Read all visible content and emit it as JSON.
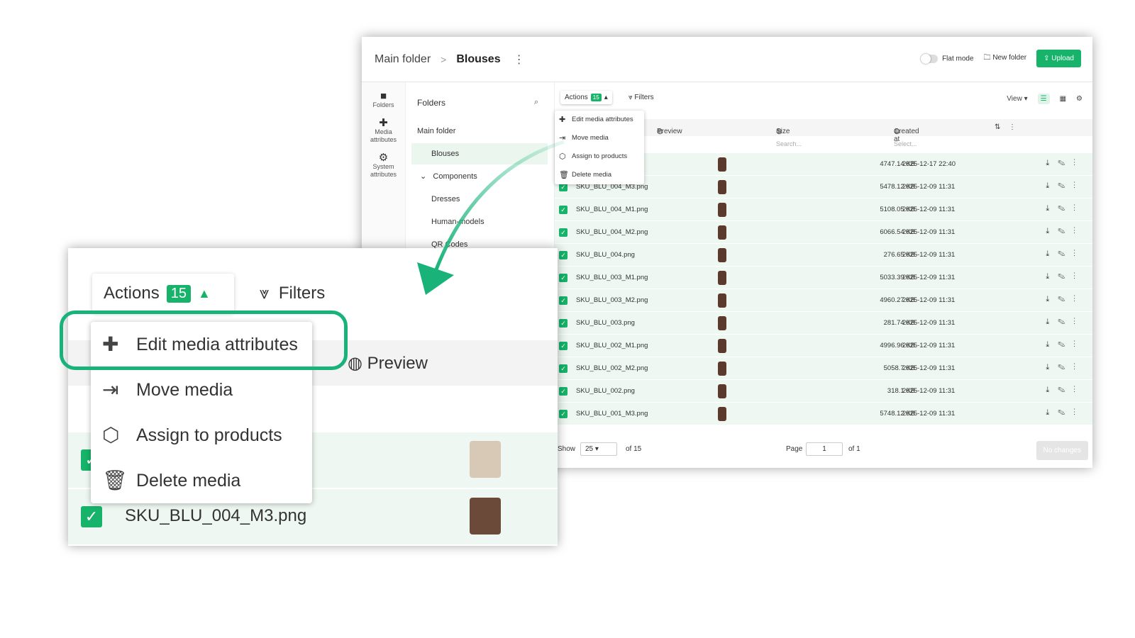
{
  "breadcrumb": {
    "root": "Main folder",
    "separator": ">",
    "current": "Blouses",
    "menu_icon": "vertical-dots-icon"
  },
  "topbar": {
    "flat_mode": "Flat mode",
    "new_folder": "New folder",
    "upload": "Upload"
  },
  "rail": [
    {
      "icon": "folder-icon",
      "label": "Folders"
    },
    {
      "icon": "puzzle-icon",
      "label": "Media attributes"
    },
    {
      "icon": "gear-icon",
      "label": "System attributes"
    }
  ],
  "folders": {
    "title": "Folders",
    "items": [
      "Main folder",
      "Blouses",
      "Components",
      "Dresses",
      "Human-models",
      "QR Codes"
    ]
  },
  "toolbar": {
    "actions": "Actions",
    "actions_count": "15",
    "filters": "Filters",
    "view": "View"
  },
  "menu": [
    "Edit media attributes",
    "Move media",
    "Assign to products",
    "Delete media"
  ],
  "table": {
    "headers": {
      "preview": "Preview",
      "size": "Size",
      "created": "Created at"
    },
    "filters": {
      "size": "Search...",
      "created": "Select..."
    },
    "rows": [
      {
        "name": "",
        "size": "4747.14 KB",
        "date": "2025-12-17 22:40"
      },
      {
        "name": "SKU_BLU_004_M3.png",
        "size": "5478.12 KB",
        "date": "2025-12-09 11:31"
      },
      {
        "name": "SKU_BLU_004_M1.png",
        "size": "5108.05 KB",
        "date": "2025-12-09 11:31"
      },
      {
        "name": "SKU_BLU_004_M2.png",
        "size": "6066.54 KB",
        "date": "2025-12-09 11:31"
      },
      {
        "name": "SKU_BLU_004.png",
        "size": "276.65 KB",
        "date": "2025-12-09 11:31"
      },
      {
        "name": "SKU_BLU_003_M1.png",
        "size": "5033.39 KB",
        "date": "2025-12-09 11:31"
      },
      {
        "name": "SKU_BLU_003_M2.png",
        "size": "4960.27 KB",
        "date": "2025-12-09 11:31"
      },
      {
        "name": "SKU_BLU_003.png",
        "size": "281.74 KB",
        "date": "2025-12-09 11:31"
      },
      {
        "name": "SKU_BLU_002_M1.png",
        "size": "4996.96 KB",
        "date": "2025-12-09 11:31"
      },
      {
        "name": "SKU_BLU_002_M2.png",
        "size": "5058.7 KB",
        "date": "2025-12-09 11:31"
      },
      {
        "name": "SKU_BLU_002.png",
        "size": "318.1 KB",
        "date": "2025-12-09 11:31"
      },
      {
        "name": "SKU_BLU_001_M3.png",
        "size": "5748.12 KB",
        "date": "2025-12-09 11:31"
      }
    ]
  },
  "footer": {
    "show": "Show",
    "page_size": "25",
    "of_total": "of 15",
    "page": "Page",
    "page_value": "1",
    "of_pages": "of 1",
    "no_changes": "No changes"
  },
  "zoom": {
    "row_name": "SKU_BLU_004_M3.png"
  },
  "colors": {
    "accent": "#17b36a"
  }
}
